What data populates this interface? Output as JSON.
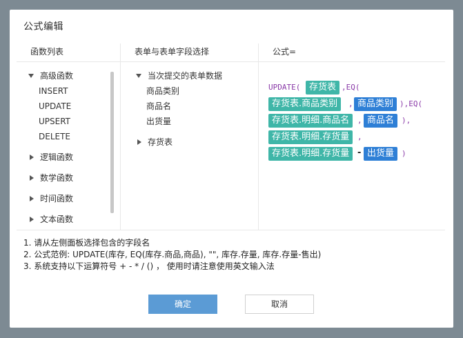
{
  "dialog": {
    "title": "公式编辑",
    "confirm_label": "确定",
    "cancel_label": "取消"
  },
  "functions_panel": {
    "header": "函数列表",
    "groups": [
      {
        "label": "高级函数",
        "expanded": true,
        "items": [
          "INSERT",
          "UPDATE",
          "UPSERT",
          "DELETE"
        ]
      },
      {
        "label": "逻辑函数",
        "expanded": false
      },
      {
        "label": "数学函数",
        "expanded": false
      },
      {
        "label": "时间函数",
        "expanded": false
      },
      {
        "label": "文本函数",
        "expanded": false
      }
    ]
  },
  "fields_panel": {
    "header": "表单与表单字段选择",
    "groups": [
      {
        "label": "当次提交的表单数据",
        "expanded": true,
        "items": [
          "商品类别",
          "商品名",
          "出货量"
        ]
      },
      {
        "label": "存货表",
        "expanded": false
      }
    ]
  },
  "formula_panel": {
    "header": "公式=",
    "tokens": {
      "update_open": "UPDATE(",
      "t1": "存货表",
      "c1": ",EQ(",
      "t2": "存货表.商品类别",
      "c2": ",",
      "t3": "商品类别",
      "c3": "),EQ(",
      "t4": "存货表.明细.商品名",
      "c4": ",",
      "t5": "商品名",
      "c5": "),",
      "t6": "存货表.明细.存货量",
      "c6": ",",
      "t7": "存货表.明细.存货量",
      "op": "-",
      "t8": "出货量",
      "close": ")"
    }
  },
  "hints": [
    "1. 请从左侧面板选择包含的字段名",
    "2. 公式范例: UPDATE(库存, EQ(库存.商品,商品), \"\", 库存.存量, 库存.存量-售出)",
    "3. 系统支持以下运算符号 + - * / () ， 使用时请注意使用英文输入法"
  ],
  "colors": {
    "field_chip": "#3fb6a8",
    "current_field_chip": "#2e7fd6",
    "function_text": "#8a3aa8",
    "primary_button": "#5b9bd5"
  }
}
